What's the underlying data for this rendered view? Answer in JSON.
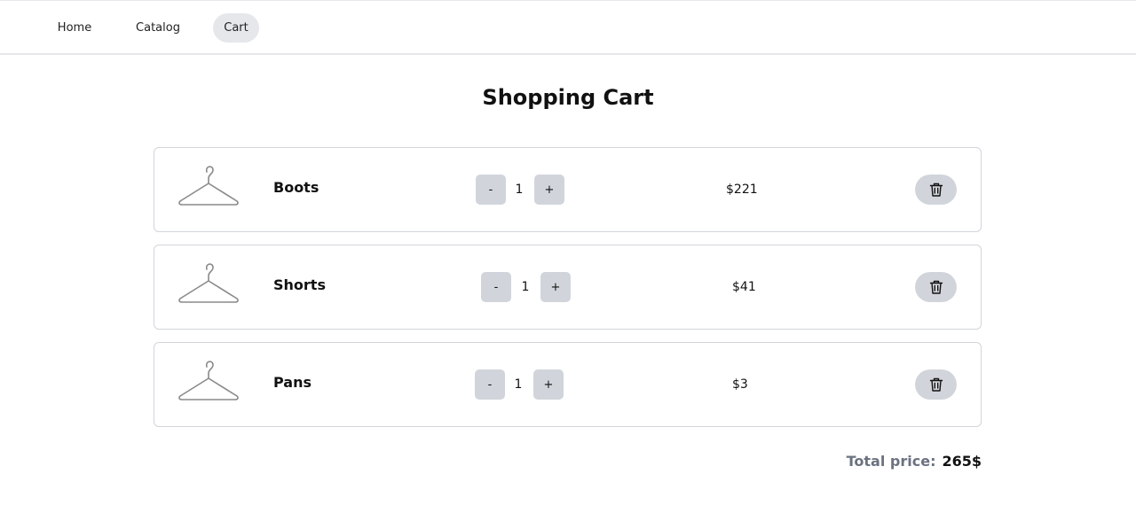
{
  "nav": {
    "home": "Home",
    "catalog": "Catalog",
    "cart": "Cart"
  },
  "page": {
    "title": "Shopping Cart"
  },
  "cart": {
    "items": [
      {
        "name": "Boots",
        "minus": "-",
        "quantity": "1",
        "plus": "+",
        "price": "$221",
        "image_icon": "hanger-icon",
        "delete_icon": "trash-icon"
      },
      {
        "name": "Shorts",
        "minus": "-",
        "quantity": "1",
        "plus": "+",
        "price": "$41",
        "image_icon": "hanger-icon",
        "delete_icon": "trash-icon"
      },
      {
        "name": "Pans",
        "minus": "-",
        "quantity": "1",
        "plus": "+",
        "price": "$3",
        "image_icon": "hanger-icon",
        "delete_icon": "trash-icon"
      }
    ],
    "total_label": "Total price:",
    "total_value": "265$"
  },
  "colors": {
    "active_nav_bg": "#e5e7eb",
    "button_bg": "#d1d5db",
    "card_border": "#d1d5db",
    "total_label": "#6b7280"
  }
}
